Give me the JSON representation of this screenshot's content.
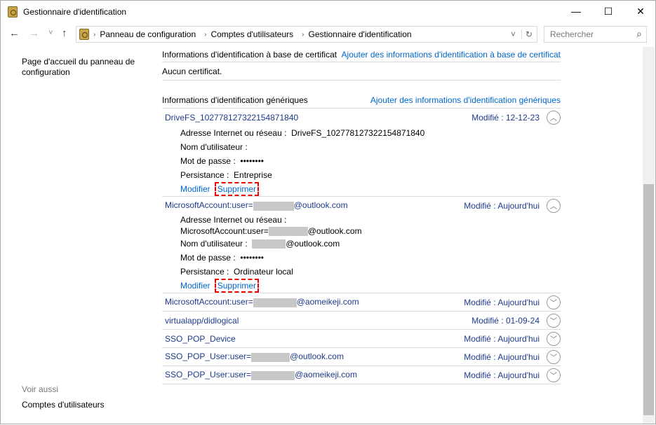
{
  "window": {
    "title": "Gestionnaire d'identification",
    "minimize": "—",
    "maximize": "☐",
    "close": "✕"
  },
  "nav": {
    "back": "←",
    "forward": "→",
    "recent": "˅",
    "up": "↑",
    "breadcrumb": [
      "Panneau de configuration",
      "Comptes d'utilisateurs",
      "Gestionnaire d'identification"
    ],
    "dropdown": "˅",
    "refresh": "↻",
    "search_placeholder": "Rechercher",
    "search_icon": "⌕"
  },
  "sidebar": {
    "home": "Page d'accueil du panneau de configuration",
    "see_also": "Voir aussi",
    "accounts": "Comptes d'utilisateurs"
  },
  "certificate": {
    "title": "Informations d'identification à base de certificat",
    "add": "Ajouter des informations d'identification à base de certificat",
    "none": "Aucun certificat."
  },
  "generic": {
    "title": "Informations d'identification génériques",
    "add": "Ajouter des informations d'identification génériques",
    "items": [
      {
        "name": "DriveFS_102778127322154871840",
        "mod_label": "Modifié :",
        "mod": "12-12-23",
        "expanded": true,
        "address_label": "Adresse Internet ou réseau :",
        "address": "DriveFS_102778127322154871840",
        "user_label": "Nom d'utilisateur :",
        "user": "",
        "pass_label": "Mot de passe :",
        "pass": "••••••••",
        "persist_label": "Persistance :",
        "persist": "Entreprise",
        "edit": "Modifier",
        "delete": "Supprimer"
      },
      {
        "name_prefix": "MicrosoftAccount:user=",
        "name_suffix": "@outlook.com",
        "mod_label": "Modifié :",
        "mod": "Aujourd'hui",
        "expanded": true,
        "address_label": "Adresse Internet ou réseau :",
        "address_prefix": "MicrosoftAccount:user=",
        "address_suffix": "@outlook.com",
        "user_label": "Nom d'utilisateur :",
        "user_suffix": "@outlook.com",
        "pass_label": "Mot de passe :",
        "pass": "••••••••",
        "persist_label": "Persistance :",
        "persist": "Ordinateur local",
        "edit": "Modifier",
        "delete": "Supprimer"
      },
      {
        "name_prefix": "MicrosoftAccount:user=",
        "name_suffix": "@aomeikeji.com",
        "mod_label": "Modifié :",
        "mod": "Aujourd'hui"
      },
      {
        "name": "virtualapp/didlogical",
        "mod_label": "Modifié :",
        "mod": "01-09-24"
      },
      {
        "name": "SSO_POP_Device",
        "mod_label": "Modifié :",
        "mod": "Aujourd'hui"
      },
      {
        "name_prefix": "SSO_POP_User:user=",
        "name_suffix": "@outlook.com",
        "mod_label": "Modifié :",
        "mod": "Aujourd'hui"
      },
      {
        "name_prefix": "SSO_POP_User:user=",
        "name_suffix": "@aomeikeji.com",
        "mod_label": "Modifié :",
        "mod": "Aujourd'hui"
      }
    ]
  },
  "icons": {
    "up": "︿",
    "down": "﹀"
  }
}
